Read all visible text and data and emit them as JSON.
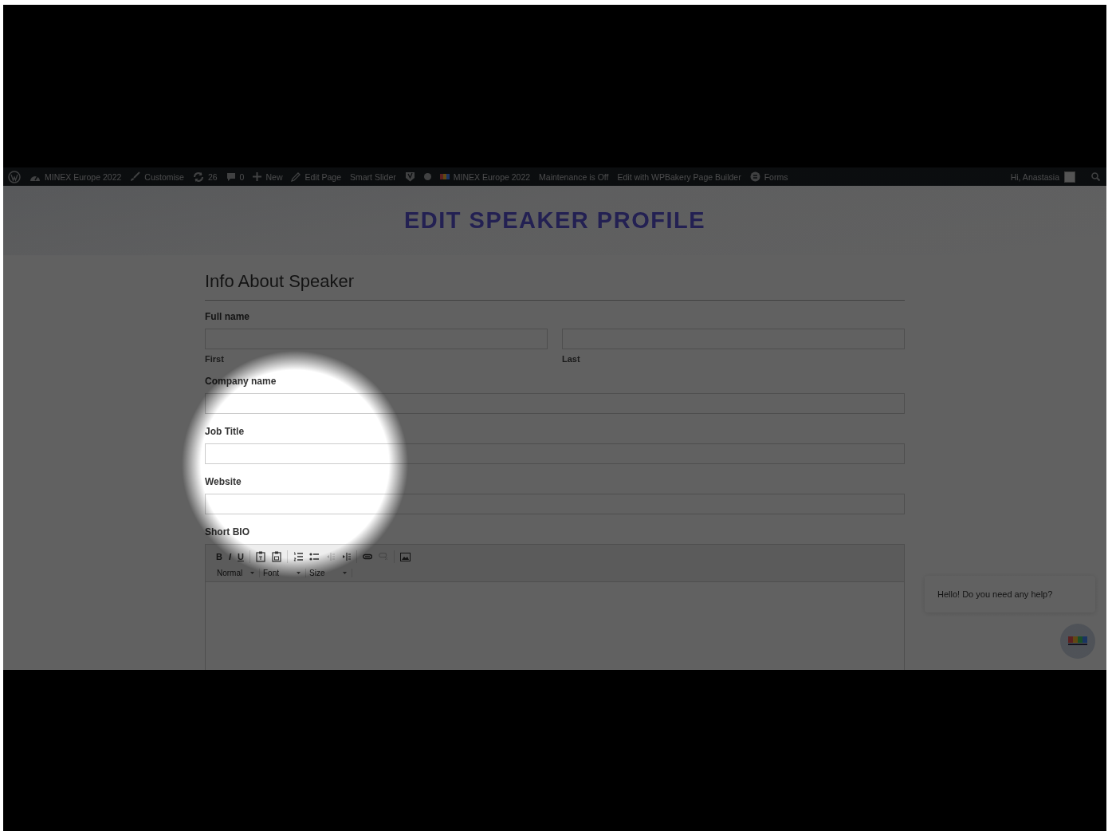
{
  "admin_bar": {
    "items": [
      {
        "kind": "wp-logo"
      },
      {
        "kind": "dashboard",
        "label": "MINEX Europe 2022"
      },
      {
        "kind": "brush",
        "label": "Customise"
      },
      {
        "kind": "refresh",
        "label": "26"
      },
      {
        "kind": "comment",
        "label": "0"
      },
      {
        "kind": "plus",
        "label": "New"
      },
      {
        "kind": "pencil",
        "label": "Edit Page"
      },
      {
        "kind": "text",
        "label": "Smart Slider"
      },
      {
        "kind": "shield"
      },
      {
        "kind": "dot"
      },
      {
        "kind": "flag",
        "label": "MINEX Europe 2022"
      },
      {
        "kind": "text",
        "label": "Maintenance is Off"
      },
      {
        "kind": "text",
        "label": "Edit with WPBakery Page Builder"
      },
      {
        "kind": "forms",
        "label": "Forms"
      }
    ],
    "greeting": "Hi, Anastasia"
  },
  "page": {
    "heading": "EDIT SPEAKER PROFILE",
    "section_title": "Info About Speaker",
    "full_name": {
      "label": "Full name",
      "sublabels": [
        "First",
        "Last"
      ]
    },
    "fields": [
      {
        "label": "Company name"
      },
      {
        "label": "Job Title"
      },
      {
        "label": "Website"
      }
    ],
    "bio": {
      "label": "Short BIO",
      "toolbar": [
        [
          {
            "kind": "bold",
            "label": "B",
            "disabled": false
          },
          {
            "kind": "italic",
            "label": "I",
            "disabled": false
          },
          {
            "kind": "underline",
            "label": "U",
            "disabled": false
          }
        ],
        [
          {
            "kind": "paste-text",
            "disabled": false
          },
          {
            "kind": "paste-word",
            "disabled": false
          }
        ],
        [
          {
            "kind": "ordered-list",
            "disabled": false
          },
          {
            "kind": "bulleted-list",
            "disabled": false
          },
          {
            "kind": "outdent",
            "disabled": true
          },
          {
            "kind": "indent",
            "disabled": false
          }
        ],
        [
          {
            "kind": "link",
            "disabled": false
          },
          {
            "kind": "unlink",
            "disabled": true
          }
        ],
        [
          {
            "kind": "image",
            "disabled": false
          }
        ]
      ],
      "dropdowns": [
        "Normal",
        "Font",
        "Size"
      ]
    }
  },
  "chat": {
    "message": "Hello! Do you need any help?"
  }
}
